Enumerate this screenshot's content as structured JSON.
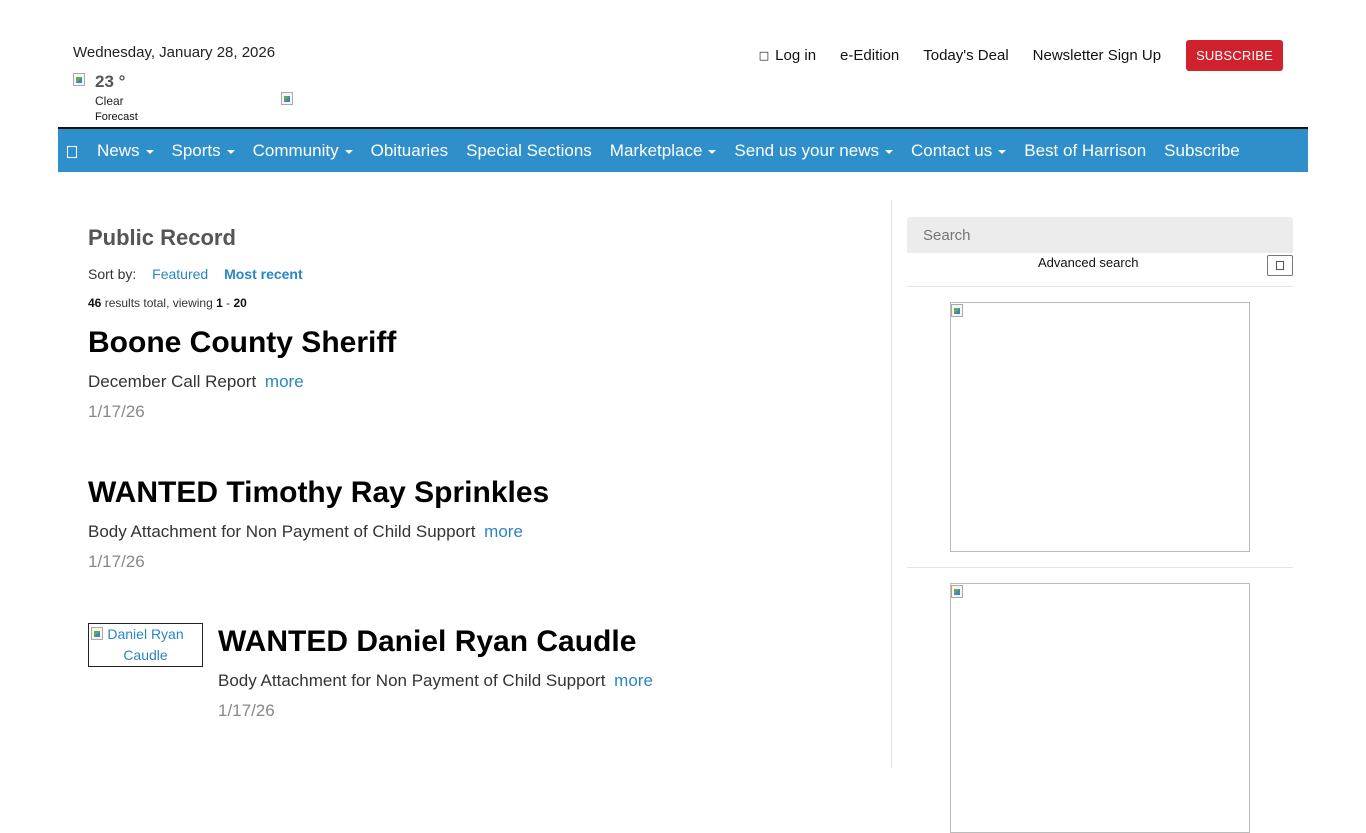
{
  "header": {
    "date": "Wednesday, January 28, 2026",
    "weather": {
      "temperature": "23 °",
      "condition": "Clear",
      "forecast_label": "Forecast"
    },
    "links": [
      {
        "label": "Log in",
        "icon": "lock-icon"
      },
      {
        "label": "e-Edition"
      },
      {
        "label": "Today's Deal"
      },
      {
        "label": "Newsletter Sign Up"
      }
    ],
    "subscribe_label": "SUBSCRIBE"
  },
  "nav": {
    "home_icon": "home-icon",
    "items": [
      {
        "label": "News",
        "dropdown": true
      },
      {
        "label": "Sports",
        "dropdown": true
      },
      {
        "label": "Community",
        "dropdown": true
      },
      {
        "label": "Obituaries",
        "dropdown": false
      },
      {
        "label": "Special Sections",
        "dropdown": false
      },
      {
        "label": "Marketplace",
        "dropdown": true
      },
      {
        "label": "Send us your news",
        "dropdown": true
      },
      {
        "label": "Contact us",
        "dropdown": true
      },
      {
        "label": "Best of Harrison",
        "dropdown": false
      },
      {
        "label": "Subscribe",
        "dropdown": false
      }
    ],
    "bg_color": "#2e8fcb"
  },
  "main": {
    "title": "Public Record",
    "sort_label": "Sort by:",
    "sort_options": [
      "Featured",
      "Most recent"
    ],
    "sort_active": "Most recent",
    "results": {
      "total": "46",
      "total_text": "results total, viewing",
      "from": "1",
      "sep": "-",
      "to": "20"
    },
    "articles": [
      {
        "title": "Boone County Sheriff",
        "summary": "December Call Report",
        "more": "more",
        "date": "1/17/26"
      },
      {
        "title": "WANTED Timothy Ray Sprinkles",
        "summary": "Body Attachment for Non Payment of Child Support",
        "more": "more",
        "date": "1/17/26"
      },
      {
        "title": "WANTED Daniel Ryan Caudle",
        "summary": "Body Attachment for Non Payment of Child Support",
        "more": "more",
        "date": "1/17/26",
        "image_alt": "Daniel Ryan Caudle"
      }
    ]
  },
  "sidebar": {
    "search_placeholder": "Search",
    "advanced_search": "Advanced search"
  },
  "colors": {
    "accent": "#2a86c3",
    "subscribe": "#d0222d"
  }
}
